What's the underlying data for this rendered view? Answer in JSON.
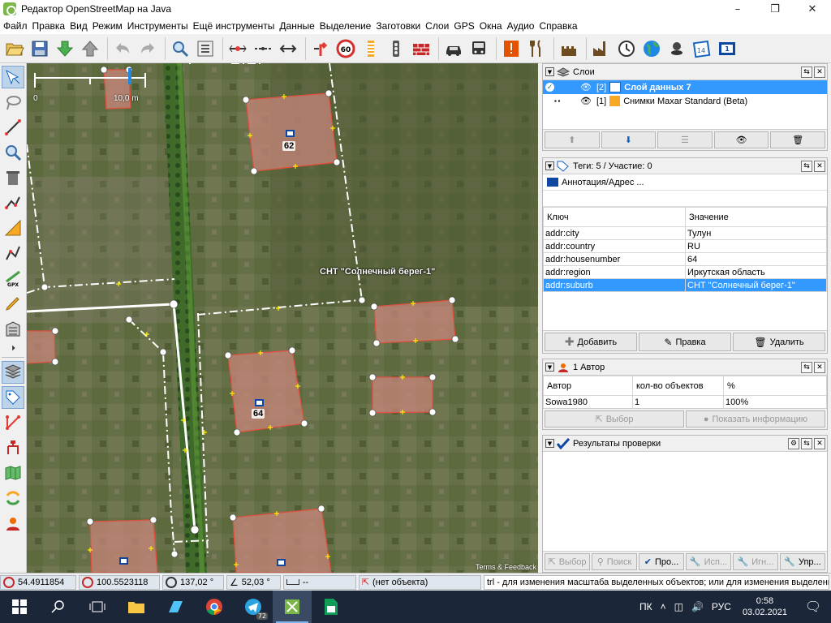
{
  "window": {
    "title": "Редактор OpenStreetMap на Java",
    "controls": [
      "minimize",
      "maximize",
      "close"
    ]
  },
  "menu": [
    "Файл",
    "Правка",
    "Вид",
    "Режим",
    "Инструменты",
    "Ещё инструменты",
    "Данные",
    "Выделение",
    "Заготовки",
    "Слои",
    "GPS",
    "Окна",
    "Аудио",
    "Справка"
  ],
  "toolbar_icons": [
    "open-icon",
    "save-icon",
    "download-icon",
    "upload-icon",
    "undo-icon",
    "redo-icon",
    "zoom-icon",
    "preferences-icon",
    "split-way-icon",
    "combine-way-icon",
    "reverse-way-icon",
    "turn-restriction-icon",
    "speed-limit-icon",
    "crossing-icon",
    "traffic-signals-icon",
    "wall-icon",
    "car-icon",
    "bus-icon",
    "warning-icon",
    "restaurant-icon",
    "castle-icon",
    "factory-icon",
    "clock-icon",
    "globe-icon",
    "pin-icon",
    "calendar-icon",
    "info-icon"
  ],
  "left_tools": [
    "select-icon",
    "lasso-icon",
    "draw-icon",
    "zoom-mode-icon",
    "delete-icon",
    "parallel-icon",
    "measure-icon",
    "improve-way-icon",
    "gpx-icon",
    "pencil-icon",
    "building-icon",
    "more-icon",
    "layers-toggle-icon",
    "tags-toggle-icon",
    "relations-icon",
    "conflict-icon",
    "map-icon",
    "history-icon",
    "author-icon"
  ],
  "map": {
    "scale": {
      "zero": "0",
      "length": "10,0 m"
    },
    "place_label": "СНТ \"Солнечный берег-1\"",
    "house_numbers": [
      "62",
      "64"
    ],
    "attribution": "Terms & Feedback"
  },
  "layers_panel": {
    "title": "Слои",
    "layers": [
      {
        "index": "[2]",
        "name": "Слой данных 7",
        "selected": true
      },
      {
        "index": "[1]",
        "name": "Снимки Maxar Standard (Beta)",
        "selected": false
      }
    ]
  },
  "tags_panel": {
    "title": "Теги: 5 / Участие: 0",
    "preset": "Аннотация/Адрес ...",
    "col_key": "Ключ",
    "col_value": "Значение",
    "rows": [
      {
        "key": "addr:city",
        "value": "Тулун"
      },
      {
        "key": "addr:country",
        "value": "RU"
      },
      {
        "key": "addr:housenumber",
        "value": "64"
      },
      {
        "key": "addr:region",
        "value": "Иркутская область"
      },
      {
        "key": "addr:suburb",
        "value": "СНТ \"Солнечный берег-1\"",
        "selected": true
      }
    ],
    "btn_add": "Добавить",
    "btn_edit": "Правка",
    "btn_delete": "Удалить"
  },
  "authors_panel": {
    "title": "1 Автор",
    "col_author": "Автор",
    "col_count": "кол-во объектов",
    "col_percent": "%",
    "rows": [
      {
        "author": "Sowa1980",
        "count": "1",
        "percent": "100%"
      }
    ],
    "btn_select": "Выбор",
    "btn_info": "Показать информацию"
  },
  "validation_panel": {
    "title": "Результаты проверки",
    "buttons": [
      "Выбор",
      "Поиск",
      "Про...",
      "Исп...",
      "Игн...",
      "Упр..."
    ]
  },
  "status": {
    "lat": "54.4911854",
    "lon": "100.5523118",
    "heading": "137,02 °",
    "angle": "52,03 °",
    "distance": "--",
    "object": "(нет объекта)",
    "hint": "trl - для изменения масштаба выделенных объектов; или для изменения выделения"
  },
  "taskbar": {
    "language": "ПК",
    "input": "РУС",
    "time": "0:58",
    "date": "03.02.2021",
    "telegram_badge": "72"
  },
  "colors": {
    "selection": "#3399ff",
    "building_fill": "#c8867a",
    "building_edge": "#e05040",
    "road": "#ffffff",
    "boundary": "#ffffff",
    "taskbar": "#1b2638"
  }
}
